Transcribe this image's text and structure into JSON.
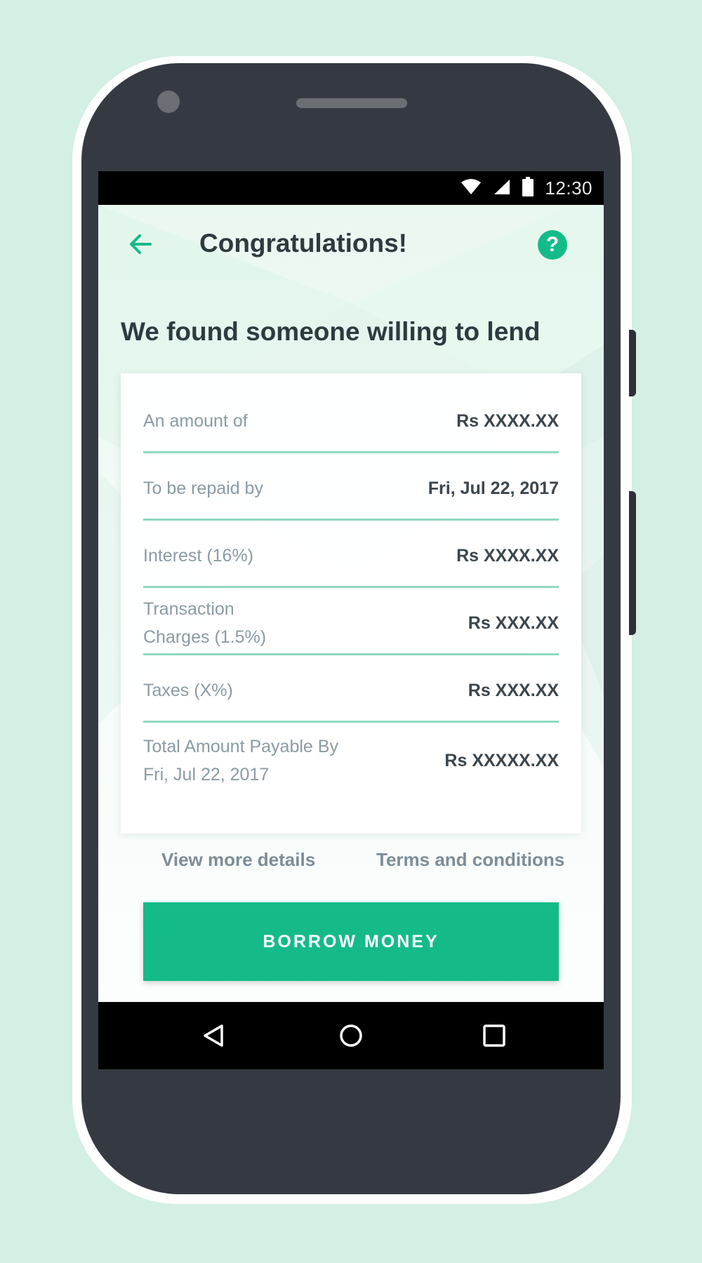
{
  "status_bar": {
    "time": "12:30"
  },
  "app_bar": {
    "title": "Congratulations!"
  },
  "heading": "We found someone willing to lend",
  "summary": {
    "rows": [
      {
        "label": "An amount of",
        "value": "Rs XXXX.XX"
      },
      {
        "label": "To be repaid by",
        "value": "Fri, Jul 22, 2017"
      },
      {
        "label": "Interest (16%)",
        "value": "Rs XXXX.XX"
      },
      {
        "label_line1": "Transaction",
        "label_line2": "Charges (1.5%)",
        "value": "Rs XXX.XX"
      },
      {
        "label": "Taxes (X%)",
        "value": "Rs XXX.XX"
      },
      {
        "label_line1": "Total Amount Payable By",
        "label_line2": "Fri, Jul 22, 2017",
        "value": "Rs XXXXX.XX"
      }
    ]
  },
  "links": {
    "view_details": "View more details",
    "terms": "Terms and conditions"
  },
  "cta": {
    "label": "BORROW MONEY"
  },
  "colors": {
    "accent": "#14bb89",
    "divider": "#8fd9bf",
    "background": "#d4efe4",
    "phone_body": "#353a42"
  },
  "icons": {
    "back": "arrow-left-icon",
    "help": "question-circle-icon",
    "wifi": "wifi-icon",
    "signal": "signal-icon",
    "battery": "battery-icon",
    "nav_back": "triangle-back-icon",
    "nav_home": "circle-home-icon",
    "nav_recents": "square-recents-icon"
  }
}
